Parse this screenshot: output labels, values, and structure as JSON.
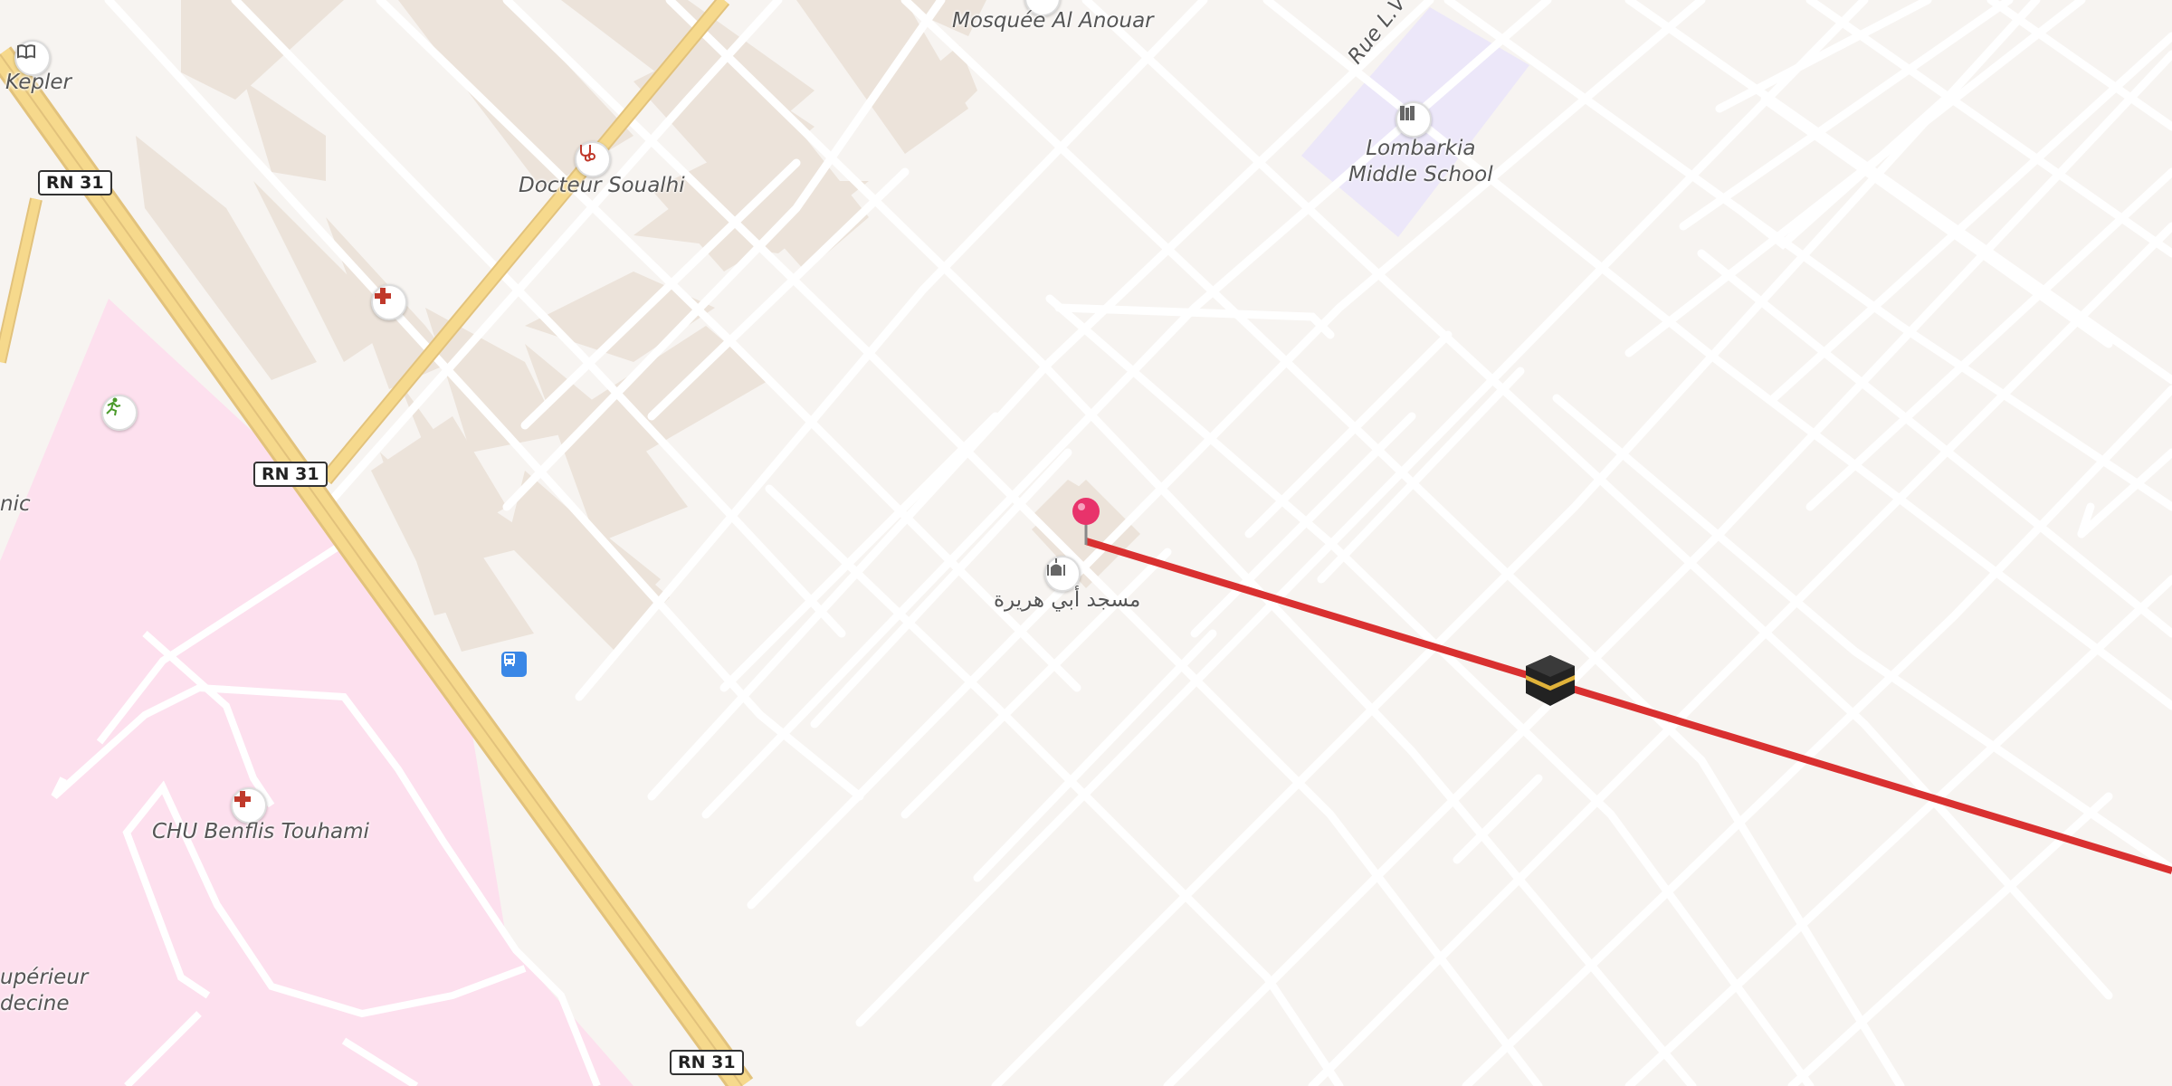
{
  "map": {
    "place_labels": [
      {
        "id": "kepler",
        "text": "Kepler"
      },
      {
        "id": "mosque-anouar",
        "text": "Mosquée Al Anouar"
      },
      {
        "id": "docteur",
        "text": "Docteur Soualhi"
      },
      {
        "id": "school",
        "text": "Lombarkia\nMiddle School"
      },
      {
        "id": "chu",
        "text": "CHU Benflis Touhami"
      },
      {
        "id": "nic",
        "text": "nic"
      },
      {
        "id": "superieur",
        "text": "upérieur\ndecine"
      },
      {
        "id": "mosque-abi",
        "text": "مسجد أبي هريرة"
      },
      {
        "id": "rue",
        "text": "Rue L.V"
      }
    ],
    "road_shields": [
      "RN 31",
      "RN 31",
      "RN 31"
    ],
    "icons": {
      "pin": "pink-location-pin-icon",
      "kaaba": "kaaba-icon",
      "qibla_line_color": "#d93030"
    },
    "colors": {
      "background": "#f7f4f1",
      "hospital_area": "#fde0ee",
      "school_area": "#ece7f9",
      "highway": "#f6d98c",
      "building": "#ece3da"
    }
  }
}
